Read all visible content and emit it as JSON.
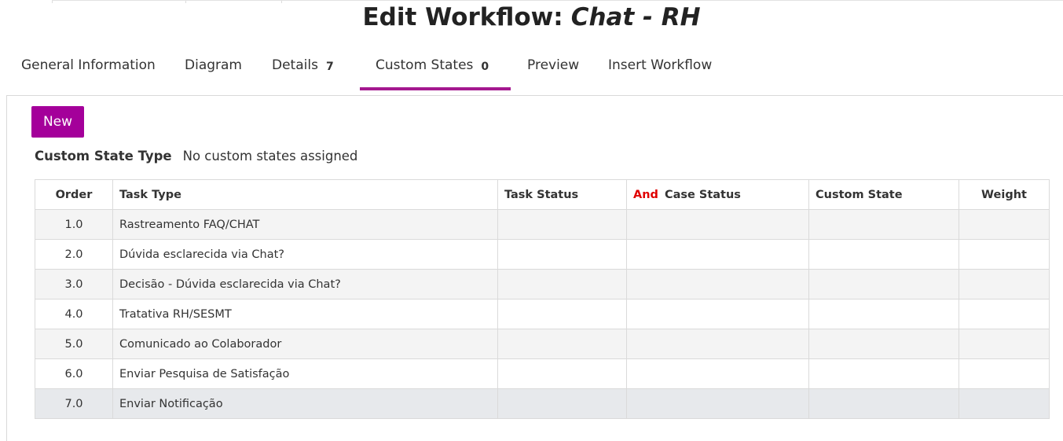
{
  "page": {
    "title_prefix": "Edit Workflow:",
    "workflow_name": "Chat - RH"
  },
  "tabs": [
    {
      "label": "General Information"
    },
    {
      "label": "Diagram"
    },
    {
      "label": "Details",
      "count": "7"
    },
    {
      "label": "Custom States",
      "count": "0",
      "active": true
    },
    {
      "label": "Preview"
    },
    {
      "label": "Insert Workflow"
    }
  ],
  "toolbar": {
    "new_label": "New"
  },
  "custom_state_type": {
    "label": "Custom State Type",
    "value": "No custom states assigned"
  },
  "table": {
    "headers": {
      "order": "Order",
      "task_type": "Task Type",
      "task_status": "Task Status",
      "and": "And",
      "case_status": "Case Status",
      "custom_state": "Custom State",
      "weight": "Weight"
    },
    "rows": [
      {
        "order": "1.0",
        "task_type": "Rastreamento FAQ/CHAT",
        "task_status": "",
        "case_status": "",
        "custom_state": "",
        "weight": ""
      },
      {
        "order": "2.0",
        "task_type": "Dúvida esclarecida via Chat?",
        "task_status": "",
        "case_status": "",
        "custom_state": "",
        "weight": ""
      },
      {
        "order": "3.0",
        "task_type": "Decisão - Dúvida esclarecida via Chat?",
        "task_status": "",
        "case_status": "",
        "custom_state": "",
        "weight": ""
      },
      {
        "order": "4.0",
        "task_type": "Tratativa RH/SESMT",
        "task_status": "",
        "case_status": "",
        "custom_state": "",
        "weight": ""
      },
      {
        "order": "5.0",
        "task_type": "Comunicado ao Colaborador",
        "task_status": "",
        "case_status": "",
        "custom_state": "",
        "weight": ""
      },
      {
        "order": "6.0",
        "task_type": "Enviar Pesquisa de Satisfação",
        "task_status": "",
        "case_status": "",
        "custom_state": "",
        "weight": ""
      },
      {
        "order": "7.0",
        "task_type": "Enviar Notificação",
        "task_status": "",
        "case_status": "",
        "custom_state": "",
        "weight": ""
      }
    ]
  },
  "colors": {
    "accent": "#a4009a",
    "tab_underline": "#a4188f",
    "and_label": "#e00000"
  }
}
